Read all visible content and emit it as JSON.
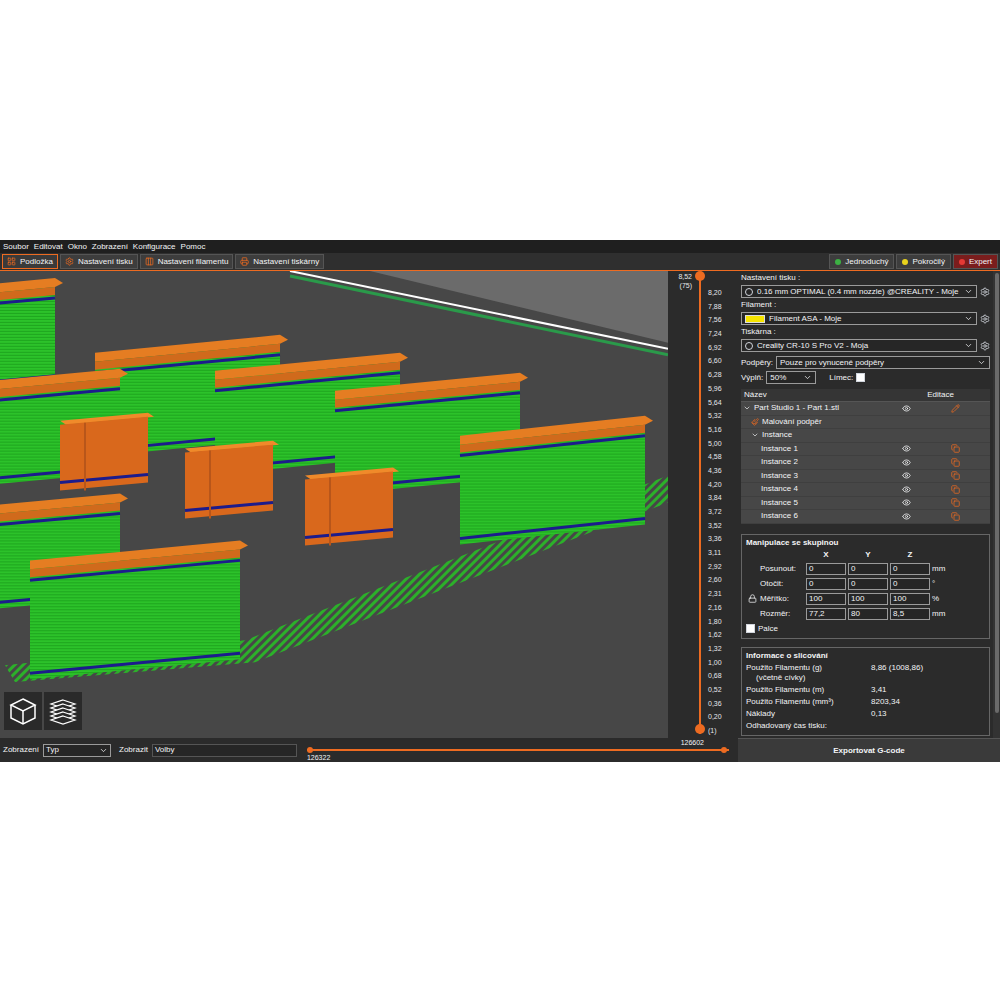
{
  "menu": [
    "Soubor",
    "Editovat",
    "Okno",
    "Zobrazení",
    "Konfigurace",
    "Pomoc"
  ],
  "tabs": [
    {
      "label": "Podložka",
      "selected": true
    },
    {
      "label": "Nastavení tisku",
      "selected": false
    },
    {
      "label": "Nastavení filamentu",
      "selected": false
    },
    {
      "label": "Nastavení tiskárny",
      "selected": false
    }
  ],
  "modes": [
    {
      "label": "Jednoduchý",
      "color": "#3cb043",
      "selected": false
    },
    {
      "label": "Pokročilý",
      "color": "#e8d21d",
      "selected": false
    },
    {
      "label": "Expert",
      "color": "#e53935",
      "selected": true
    }
  ],
  "layer_slider": {
    "top_value": "8,52",
    "top_layer": "(75)",
    "ticks": [
      "8,20",
      "7,88",
      "7,56",
      "7,24",
      "6,92",
      "6,60",
      "6,28",
      "5,96",
      "5,64",
      "5,32",
      "5,16",
      "5,00",
      "4,58",
      "4,36",
      "4,20",
      "3,84",
      "3,72",
      "3,52",
      "3,36",
      "3,11",
      "2,92",
      "2,60",
      "2,31",
      "2,16",
      "1,80",
      "1,62",
      "1,32",
      "1,00",
      "0,68",
      "0,52",
      "0,36"
    ],
    "bottom_value": "0,20",
    "bottom_layer": "(1)",
    "upper_level": 1,
    "lower_level": 0
  },
  "move_slider": {
    "upper": "126602",
    "lower": "126322",
    "start_level": 0,
    "end_level": 1
  },
  "view_bar": {
    "view_label": "Zobrazení",
    "view_value": "Typ",
    "show_label": "Zobrazit",
    "show_value": "Volby"
  },
  "sidebar": {
    "print": {
      "label": "Nastavení tisku :",
      "value": "0.16 mm OPTIMAL (0.4 mm nozzle) @CREALITY - Moje"
    },
    "filament": {
      "label": "Filament :",
      "value": "Filament ASA - Moje"
    },
    "printer": {
      "label": "Tiskárna :",
      "value": "Creality CR-10 S Pro V2 - Moja"
    },
    "supports": {
      "label": "Podpěry:",
      "value": "Pouze pro vynucené podpěry"
    },
    "infill": {
      "label": "Výplň:",
      "value": "50%"
    },
    "brim": {
      "label": "Límec:",
      "checked": false
    },
    "objects": {
      "columns": [
        "Název",
        "Editace"
      ],
      "items": [
        {
          "kind": "object",
          "label": "Part Studio 1 - Part 1.stl",
          "expanded": true,
          "visible": true
        },
        {
          "kind": "paint",
          "label": "Malování podpěr"
        },
        {
          "kind": "group",
          "label": "Instance",
          "expanded": true
        },
        {
          "kind": "instance",
          "label": "Instance 1",
          "visible": true
        },
        {
          "kind": "instance",
          "label": "Instance 2",
          "visible": true
        },
        {
          "kind": "instance",
          "label": "Instance 3",
          "visible": true
        },
        {
          "kind": "instance",
          "label": "Instance 4",
          "visible": true
        },
        {
          "kind": "instance",
          "label": "Instance 5",
          "visible": true
        },
        {
          "kind": "instance",
          "label": "Instance 6",
          "visible": true
        }
      ]
    },
    "manipulation": {
      "title": "Manipulace se skupinou",
      "axes": [
        "X",
        "Y",
        "Z"
      ],
      "rows": [
        {
          "label": "Posunout:",
          "values": [
            "0",
            "0",
            "0"
          ],
          "unit": "mm",
          "locked": false
        },
        {
          "label": "Otočit:",
          "values": [
            "0",
            "0",
            "0"
          ],
          "unit": "°",
          "locked": false
        },
        {
          "label": "Měřítko:",
          "values": [
            "100",
            "100",
            "100"
          ],
          "unit": "%",
          "locked": true
        },
        {
          "label": "Rozměr:",
          "values": [
            "77,2",
            "80",
            "8,5"
          ],
          "unit": "mm",
          "locked": false
        }
      ],
      "inches": {
        "label": "Palce",
        "checked": false
      }
    },
    "slicing_info": {
      "title": "Informace o slicování",
      "rows": [
        {
          "label": "Použito Filamentu (g)",
          "sublabel": "(včetně cívky)",
          "value": "8,86 (1008,86)"
        },
        {
          "label": "Použito Filamentu (m)",
          "value": "3,41"
        },
        {
          "label": "Použito Filamentu (mm³)",
          "value": "8203,34"
        },
        {
          "label": "Náklady",
          "value": "0,13"
        },
        {
          "label": "Odhadovaný čas tisku:"
        }
      ]
    }
  },
  "export_button": "Exportovat G-code"
}
